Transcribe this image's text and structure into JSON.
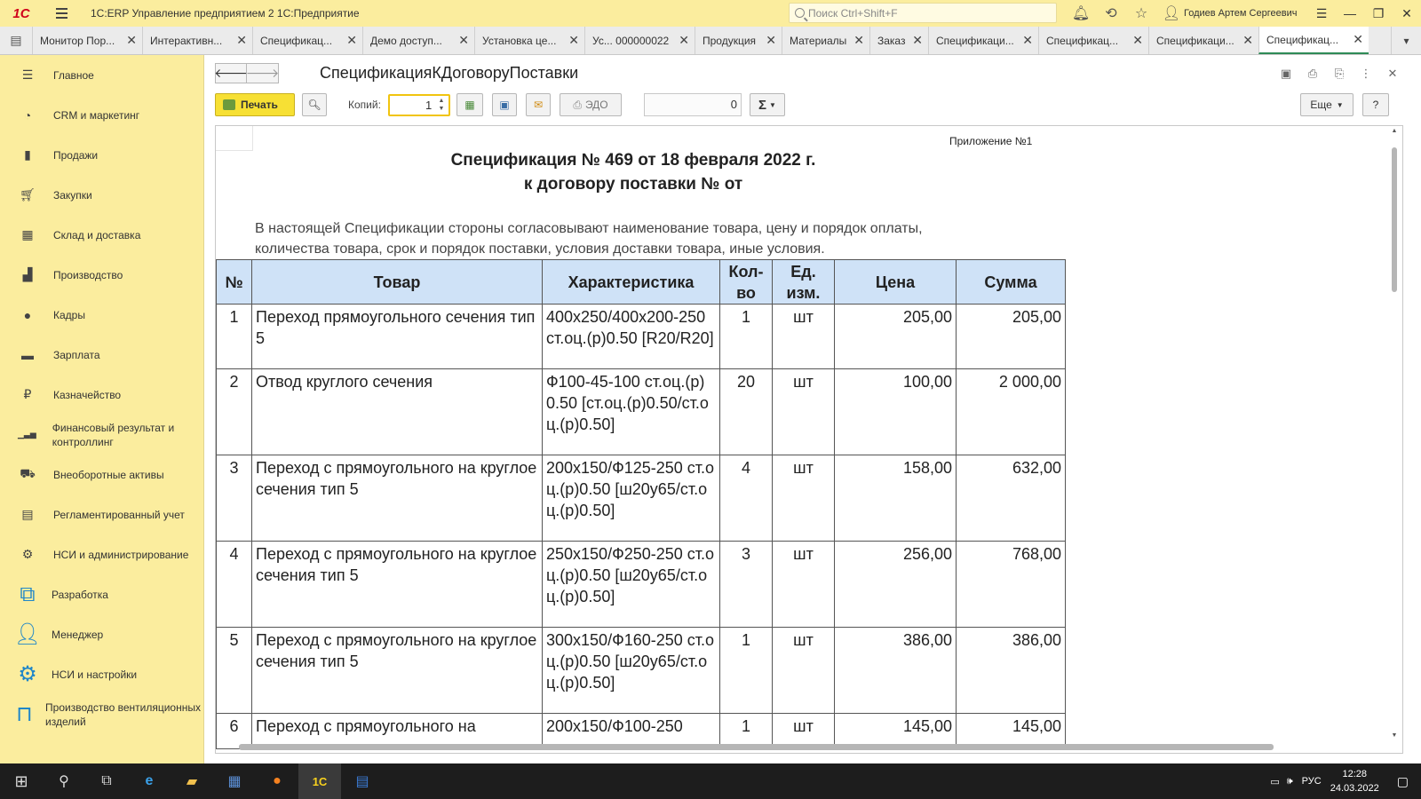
{
  "window": {
    "app_title": "1С:ERP Управление предприятием 2 1С:Предприятие",
    "search_placeholder": "Поиск Ctrl+Shift+F",
    "user": "Годиев Артем Сергеевич"
  },
  "tabs": [
    {
      "label": "Монитор Пор..."
    },
    {
      "label": "Интерактивн..."
    },
    {
      "label": "Спецификац..."
    },
    {
      "label": "Демо доступ..."
    },
    {
      "label": "Установка це..."
    },
    {
      "label": "Ус... 000000022"
    },
    {
      "label": "Продукция"
    },
    {
      "label": "Материалы"
    },
    {
      "label": "Заказ"
    },
    {
      "label": "Спецификаци..."
    },
    {
      "label": "Спецификац..."
    },
    {
      "label": "Спецификаци..."
    },
    {
      "label": "Спецификац...",
      "active": true
    }
  ],
  "sidebar": {
    "items": [
      {
        "label": "Главное",
        "icon": "menu-lines-icon"
      },
      {
        "label": "CRM и маркетинг",
        "icon": "pie-chart-icon"
      },
      {
        "label": "Продажи",
        "icon": "bag-icon"
      },
      {
        "label": "Закупки",
        "icon": "cart-icon"
      },
      {
        "label": "Склад и доставка",
        "icon": "grid-icon"
      },
      {
        "label": "Производство",
        "icon": "factory-icon"
      },
      {
        "label": "Кадры",
        "icon": "person-icon"
      },
      {
        "label": "Зарплата",
        "icon": "wallet-icon"
      },
      {
        "label": "Казначейство",
        "icon": "coin-icon"
      },
      {
        "label": "Финансовый результат и контроллинг",
        "icon": "bar-chart-icon"
      },
      {
        "label": "Внеоборотные активы",
        "icon": "car-icon"
      },
      {
        "label": "Регламентированный учет",
        "icon": "report-icon"
      },
      {
        "label": "НСИ и администрирование",
        "icon": "gear-icon"
      },
      {
        "label": "Разработка",
        "icon": "dev-icon"
      },
      {
        "label": "Менеджер",
        "icon": "manager-icon"
      },
      {
        "label": "НСИ и настройки",
        "icon": "gears-icon"
      },
      {
        "label": "Производство вентиляционных изделий",
        "icon": "vent-icon"
      }
    ]
  },
  "form": {
    "title": "СпецификацияКДоговоруПоставки",
    "print_label": "Печать",
    "copies_label": "Копий:",
    "copies_value": "1",
    "edo_label": "ЭДО",
    "counter_value": "0",
    "sum_label": "Σ",
    "more_label": "Еще",
    "help_label": "?"
  },
  "document": {
    "appendix": "Приложение №1",
    "title_line1": "Спецификация № 469   от 18 февраля 2022 г.",
    "title_line2": "к договору поставки №  от",
    "intro": "В настоящей Спецификации стороны согласовывают наименование товара, цену и порядок оплаты, количества товара, срок и порядок поставки, условия доставки товара, иные условия.",
    "headers": {
      "num": "№",
      "product": "Товар",
      "spec": "Характеристика",
      "qty": "Кол-во",
      "unit": "Ед. изм.",
      "price": "Цена",
      "sum": "Сумма"
    },
    "rows": [
      {
        "num": "1",
        "product": "Переход прямоугольного сечения тип 5",
        "spec": "400х250/400х200-250  ст.оц.(р)0.50 [R20/R20]",
        "qty": "1",
        "unit": "шт",
        "price": "205,00",
        "sum": "205,00"
      },
      {
        "num": "2",
        "product": "Отвод круглого сечения",
        "spec": "Ф100-45-100 ст.оц.(р)0.50 [ст.оц.(р)0.50/ст.оц.(р)0.50]",
        "qty": "20",
        "unit": "шт",
        "price": "100,00",
        "sum": "2 000,00"
      },
      {
        "num": "3",
        "product": "Переход с прямоугольного на круглое сечения тип 5",
        "spec": "200х150/Ф125-250 ст.оц.(р)0.50 [ш20у65/ст.оц.(р)0.50]",
        "qty": "4",
        "unit": "шт",
        "price": "158,00",
        "sum": "632,00"
      },
      {
        "num": "4",
        "product": "Переход с прямоугольного на круглое сечения тип 5",
        "spec": "250х150/Ф250-250 ст.оц.(р)0.50 [ш20у65/ст.оц.(р)0.50]",
        "qty": "3",
        "unit": "шт",
        "price": "256,00",
        "sum": "768,00"
      },
      {
        "num": "5",
        "product": "Переход с прямоугольного на круглое сечения тип 5",
        "spec": "300х150/Ф160-250 ст.оц.(р)0.50 [ш20у65/ст.оц.(р)0.50]",
        "qty": "1",
        "unit": "шт",
        "price": "386,00",
        "sum": "386,00"
      },
      {
        "num": "6",
        "product": "Переход с прямоугольного на",
        "spec": "200х150/Ф100-250",
        "qty": "1",
        "unit": "шт",
        "price": "145,00",
        "sum": "145,00"
      }
    ]
  },
  "taskbar": {
    "lang": "РУС",
    "time": "12:28",
    "date": "24.03.2022"
  }
}
